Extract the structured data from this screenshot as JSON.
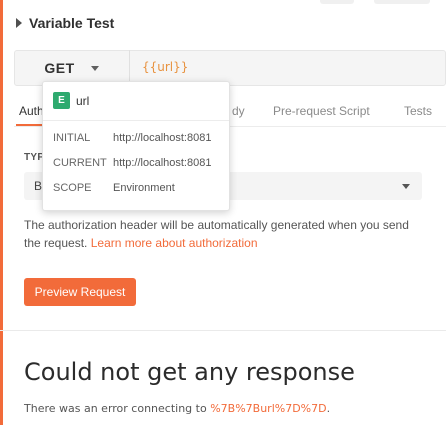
{
  "request": {
    "name": "Variable Test"
  },
  "method": {
    "value": "GET",
    "chevron_icon": "chevron-down-icon"
  },
  "url": {
    "value": "{{url}}"
  },
  "tabs": [
    {
      "label": "Auth",
      "active": true
    },
    {
      "label": "dy",
      "active": false
    },
    {
      "label": "Pre-request Script",
      "active": false
    },
    {
      "label": "Tests",
      "active": false
    }
  ],
  "auth": {
    "type_label": "TYP",
    "type_value": "B",
    "description": "The authorization header will be automatically generated when you send the request.",
    "learn_more": "Learn more about authorization",
    "preview_button": "Preview Request"
  },
  "variable_popover": {
    "scope_badge": "E",
    "variable_name": "url",
    "rows": [
      {
        "key": "INITIAL",
        "value": "http://localhost:8081"
      },
      {
        "key": "CURRENT",
        "value": "http://localhost:8081"
      },
      {
        "key": "SCOPE",
        "value": "Environment"
      }
    ]
  },
  "response": {
    "title": "Could not get any response",
    "error_prefix": "There was an error connecting to",
    "error_link": "%7B%7Burl%7D%7D",
    "error_suffix": "."
  },
  "colors": {
    "accent": "#f26b3a",
    "variable": "#e8923f",
    "environment_badge": "#2eaa6f"
  }
}
